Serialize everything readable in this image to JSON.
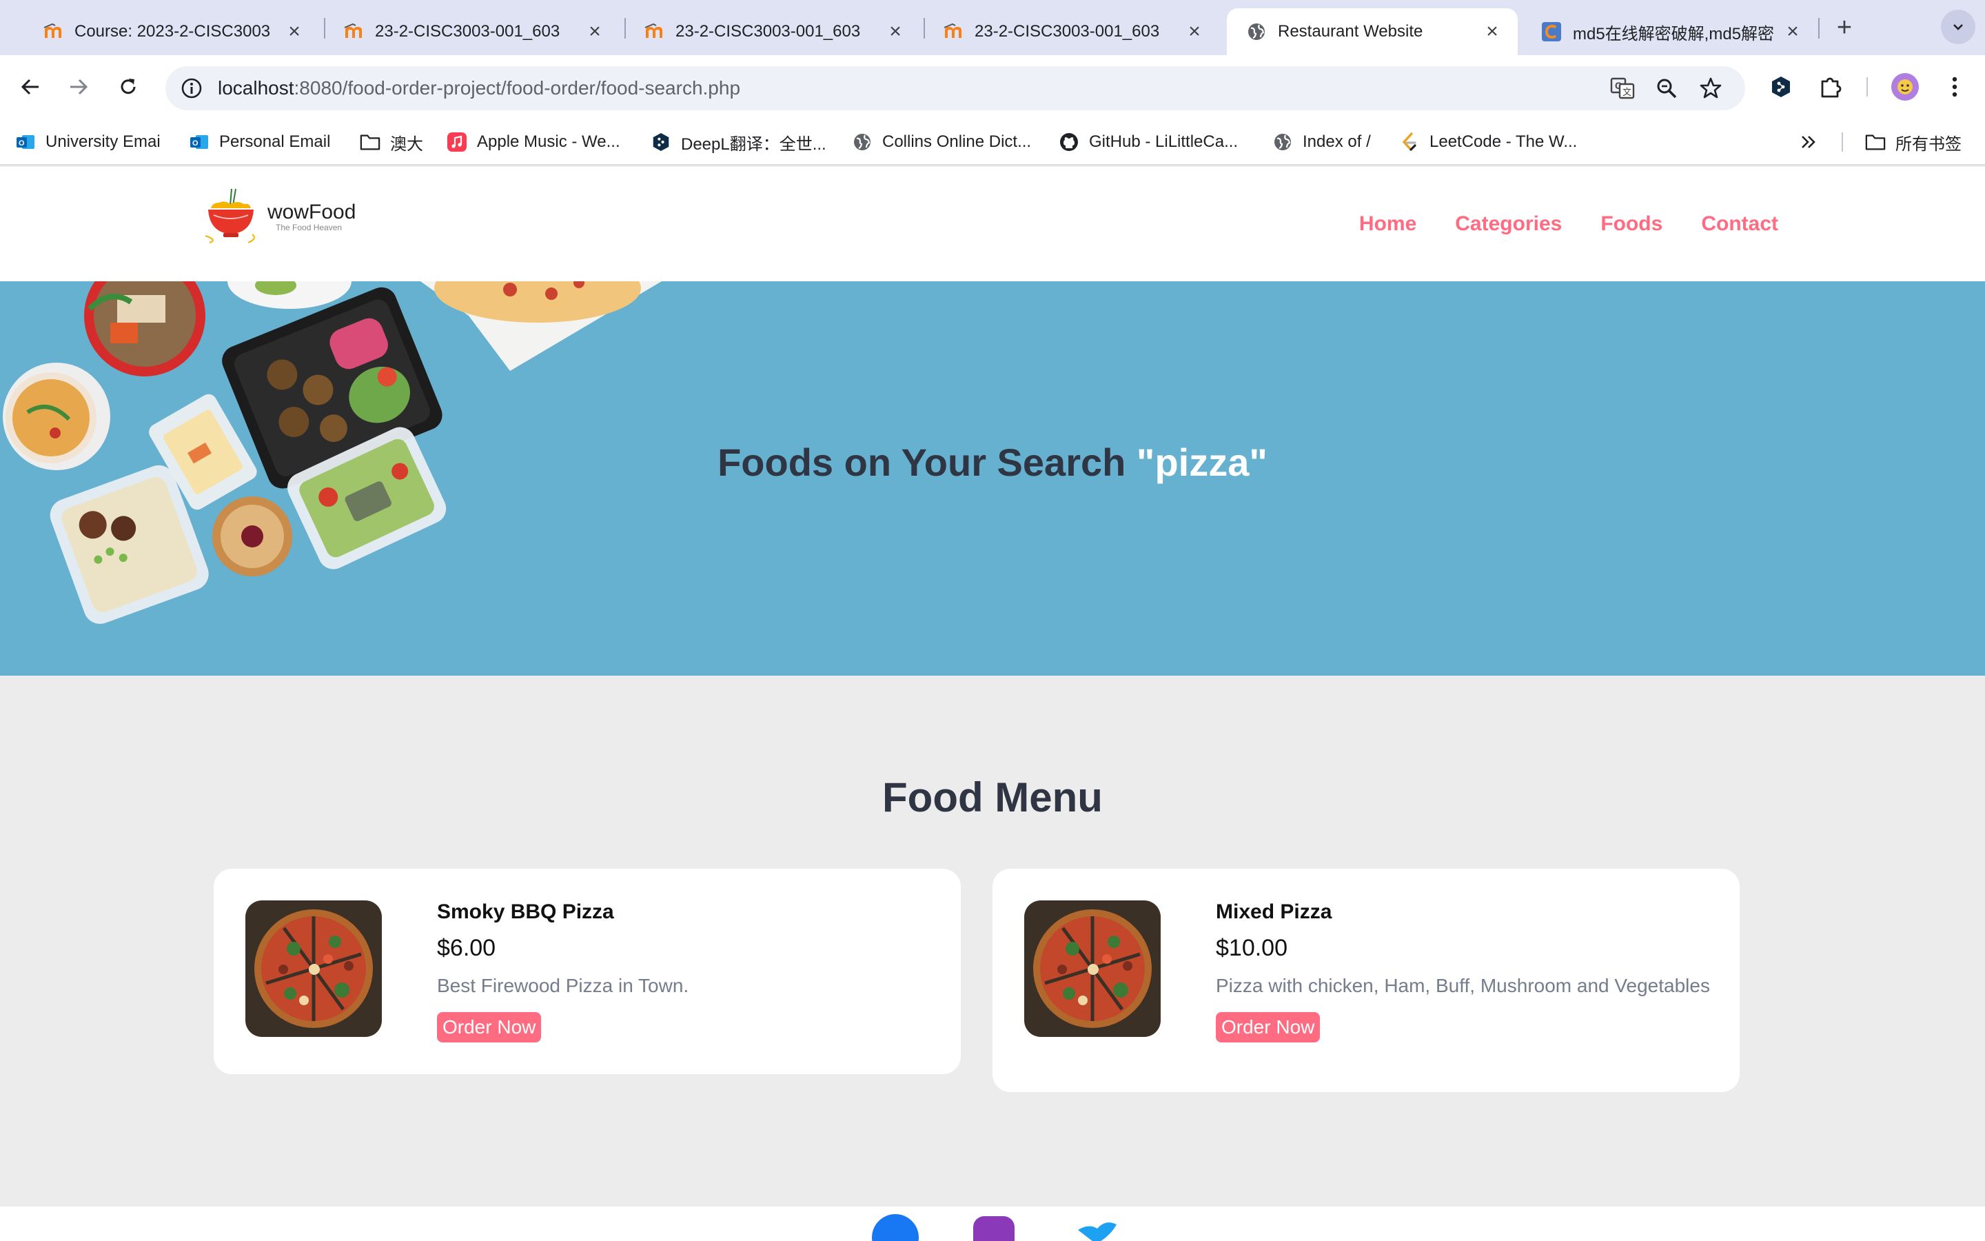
{
  "browser": {
    "tabs": [
      {
        "title": "Course: 2023-2-CISC3003",
        "icon": "moodle-icon"
      },
      {
        "title": "23-2-CISC3003-001_603",
        "icon": "moodle-icon"
      },
      {
        "title": "23-2-CISC3003-001_603",
        "icon": "moodle-icon"
      },
      {
        "title": "23-2-CISC3003-001_603",
        "icon": "moodle-icon"
      },
      {
        "title": "Restaurant Website",
        "icon": "globe-icon",
        "active": true
      },
      {
        "title": "md5在线解密破解,md5解密",
        "icon": "cmd5-icon"
      }
    ],
    "url_host": "localhost",
    "url_rest": ":8080/food-order-project/food-order/food-search.php",
    "bookmarks": [
      {
        "label": "University Emai",
        "icon": "outlook-icon"
      },
      {
        "label": "Personal Email",
        "icon": "outlook-icon"
      },
      {
        "label": "澳大",
        "icon": "folder-icon"
      },
      {
        "label": "Apple Music - We...",
        "icon": "apple-music-icon"
      },
      {
        "label": "DeepL翻译：全世...",
        "icon": "deepl-icon"
      },
      {
        "label": "Collins Online Dict...",
        "icon": "globe-icon"
      },
      {
        "label": "GitHub - LiLittleCa...",
        "icon": "github-icon"
      },
      {
        "label": "Index of /",
        "icon": "globe-icon"
      },
      {
        "label": "LeetCode - The W...",
        "icon": "leetcode-icon"
      }
    ],
    "all_bookmarks": "所有书签"
  },
  "site": {
    "logo_name": "wowFood",
    "logo_tagline": "The Food Heaven",
    "nav": [
      "Home",
      "Categories",
      "Foods",
      "Contact"
    ]
  },
  "hero": {
    "heading_prefix": "Foods on Your Search ",
    "keyword": "\"pizza\""
  },
  "food_menu": {
    "title": "Food Menu",
    "items": [
      {
        "name": "Smoky BBQ Pizza",
        "price": "$6.00",
        "description": "Best Firewood Pizza in Town.",
        "button": "Order Now"
      },
      {
        "name": "Mixed Pizza",
        "price": "$10.00",
        "description": "Pizza with chicken, Ham, Buff, Mushroom and Vegetables",
        "button": "Order Now"
      }
    ]
  },
  "colors": {
    "accent": "#ff6b81",
    "hero_bg": "#66b0d0",
    "heading": "#2f3542",
    "tabstrip": "#dfe3f3"
  }
}
